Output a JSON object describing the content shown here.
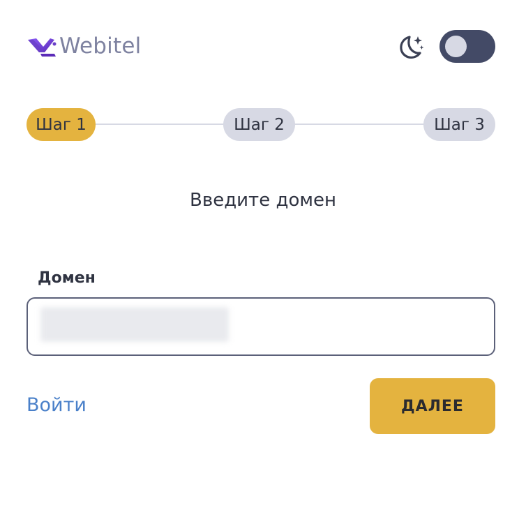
{
  "header": {
    "logo_text": "Webitel",
    "theme_icon": "moon-stars-icon",
    "theme_toggle": {
      "state": "off"
    }
  },
  "stepper": {
    "steps": [
      {
        "label": "Шаг 1",
        "active": true
      },
      {
        "label": "Шаг 2",
        "active": false
      },
      {
        "label": "Шаг 3",
        "active": false
      }
    ]
  },
  "main": {
    "title": "Введите домен",
    "domain_field": {
      "label": "Домен",
      "value": "",
      "value_blurred": true
    },
    "login_link": "Войти",
    "next_button": "ДАЛЕЕ"
  },
  "colors": {
    "accent": "#e4b33f",
    "step_inactive": "#d7d9e4",
    "toggle_track": "#434a66",
    "link": "#4a80c9",
    "logo_text": "#7e82a0",
    "logo_mark": "#6a3fc8"
  }
}
